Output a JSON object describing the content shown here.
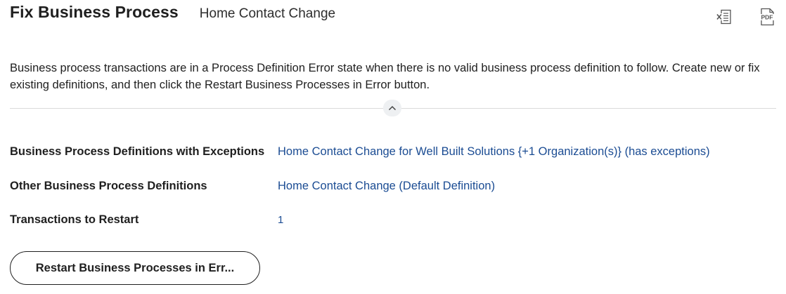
{
  "header": {
    "title": "Fix Business Process",
    "subtitle": "Home Contact Change",
    "export_excel_icon": "excel-export-icon",
    "export_pdf_label": "PDF"
  },
  "description": "Business process transactions are in a Process Definition Error state when there is no valid business process definition to follow. Create new or fix existing definitions, and then click the Restart Business Processes in Error button.",
  "collapse_icon": "chevron-up-icon",
  "fields": [
    {
      "label": "Business Process Definitions with Exceptions",
      "value": "Home Contact Change for Well Built Solutions {+1 Organization(s)} (has exceptions)"
    },
    {
      "label": "Other Business Process Definitions",
      "value": "Home Contact Change (Default Definition)"
    },
    {
      "label": "Transactions to Restart",
      "value": "1"
    }
  ],
  "actions": {
    "restart_label": "Restart Business Processes in Err..."
  },
  "colors": {
    "link": "#1b4c93",
    "text": "#1f1f1f",
    "divider": "#dadada"
  }
}
